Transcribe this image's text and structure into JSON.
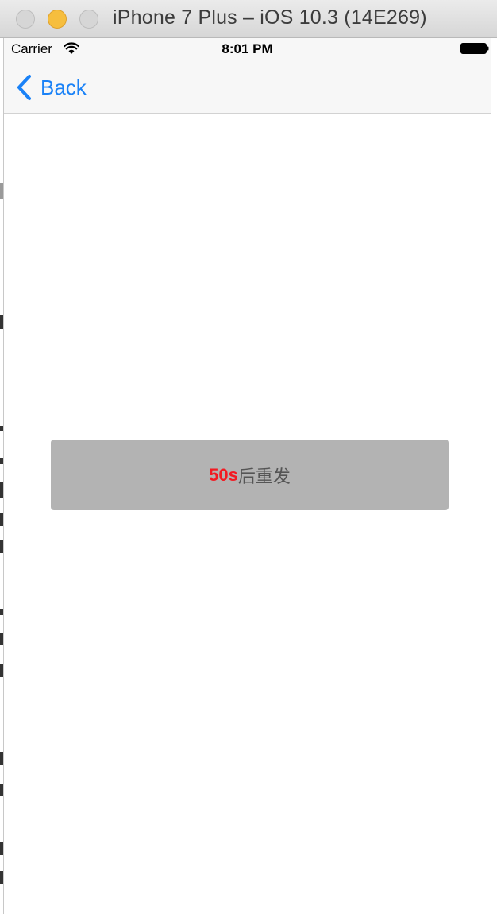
{
  "window": {
    "title": "iPhone 7 Plus – iOS 10.3 (14E269)"
  },
  "status_bar": {
    "carrier": "Carrier",
    "time": "8:01 PM",
    "icons": [
      "wifi-icon",
      "battery-icon"
    ]
  },
  "nav_bar": {
    "back_label": "Back",
    "back_icon": "chevron-left-icon",
    "tint_color": "#1a82f7"
  },
  "resend_button": {
    "countdown": "50s",
    "suffix": "后重发",
    "countdown_color": "#f31a22",
    "background_color": "#b3b3b3"
  }
}
